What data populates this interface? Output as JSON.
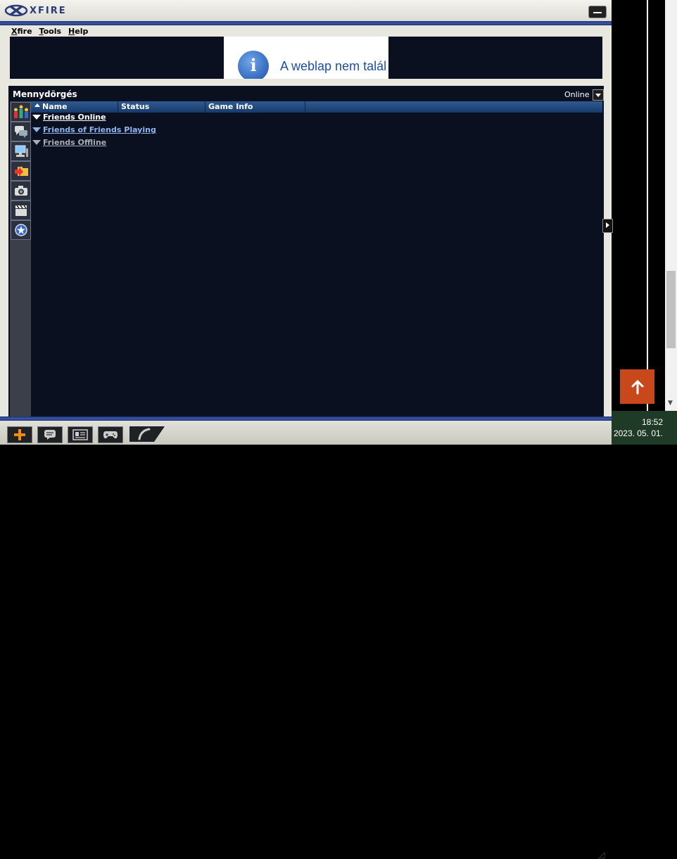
{
  "window": {
    "logo_text": "XFIRE",
    "menu": [
      {
        "label": "Xfire",
        "accel": "X"
      },
      {
        "label": "Tools",
        "accel": "T"
      },
      {
        "label": "Help",
        "accel": "H"
      }
    ],
    "ad_text": "A weblap nem talál"
  },
  "user": {
    "name": "Mennydörgés",
    "status": "Online"
  },
  "list": {
    "columns": [
      "Name",
      "Status",
      "Game Info"
    ],
    "groups": [
      {
        "label": "Friends Online",
        "color": "#ffffff"
      },
      {
        "label": "Friends of Friends Playing",
        "color": "#8fb5ee"
      },
      {
        "label": "Friends Offline",
        "color": "#a9adb6"
      }
    ]
  },
  "sidebar_icons": [
    "friends-icon",
    "chat-icon",
    "servers-icon",
    "downloads-icon",
    "screenshots-icon",
    "videos-icon",
    "extras-icon"
  ],
  "bottom_icons": [
    "add-icon",
    "message-icon",
    "profile-icon",
    "gamepad-icon",
    "voice-icon"
  ],
  "clock": {
    "time": "18:52",
    "date": "2023. 05. 01."
  },
  "colors": {
    "panel_bg": "#0b1020",
    "chrome_bar": "#1a2f73",
    "scroll_top_button": "#c8481c"
  }
}
